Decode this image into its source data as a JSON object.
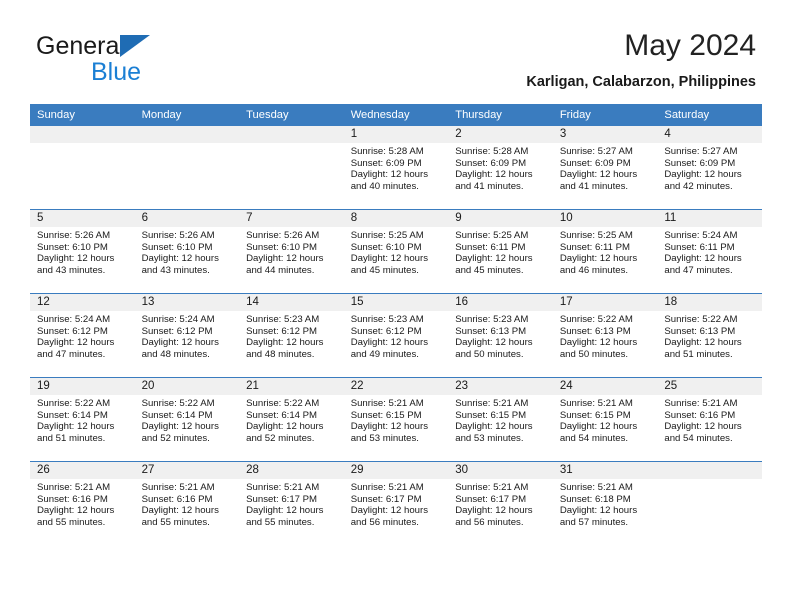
{
  "brand": {
    "name_line1": "General",
    "name_line2": "Blue",
    "triangle_color": "#1f6cb4",
    "blue_text_color": "#1b7fd4"
  },
  "header": {
    "month_title": "May 2024",
    "location": "Karligan, Calabarzon, Philippines"
  },
  "calendar": {
    "header_bg": "#3a7cbf",
    "daynum_bg": "#f0f0f0",
    "weekdays": [
      "Sunday",
      "Monday",
      "Tuesday",
      "Wednesday",
      "Thursday",
      "Friday",
      "Saturday"
    ],
    "weeks": [
      [
        {
          "day": "",
          "lines": []
        },
        {
          "day": "",
          "lines": []
        },
        {
          "day": "",
          "lines": []
        },
        {
          "day": "1",
          "lines": [
            "Sunrise: 5:28 AM",
            "Sunset: 6:09 PM",
            "Daylight: 12 hours",
            "and 40 minutes."
          ]
        },
        {
          "day": "2",
          "lines": [
            "Sunrise: 5:28 AM",
            "Sunset: 6:09 PM",
            "Daylight: 12 hours",
            "and 41 minutes."
          ]
        },
        {
          "day": "3",
          "lines": [
            "Sunrise: 5:27 AM",
            "Sunset: 6:09 PM",
            "Daylight: 12 hours",
            "and 41 minutes."
          ]
        },
        {
          "day": "4",
          "lines": [
            "Sunrise: 5:27 AM",
            "Sunset: 6:09 PM",
            "Daylight: 12 hours",
            "and 42 minutes."
          ]
        }
      ],
      [
        {
          "day": "5",
          "lines": [
            "Sunrise: 5:26 AM",
            "Sunset: 6:10 PM",
            "Daylight: 12 hours",
            "and 43 minutes."
          ]
        },
        {
          "day": "6",
          "lines": [
            "Sunrise: 5:26 AM",
            "Sunset: 6:10 PM",
            "Daylight: 12 hours",
            "and 43 minutes."
          ]
        },
        {
          "day": "7",
          "lines": [
            "Sunrise: 5:26 AM",
            "Sunset: 6:10 PM",
            "Daylight: 12 hours",
            "and 44 minutes."
          ]
        },
        {
          "day": "8",
          "lines": [
            "Sunrise: 5:25 AM",
            "Sunset: 6:10 PM",
            "Daylight: 12 hours",
            "and 45 minutes."
          ]
        },
        {
          "day": "9",
          "lines": [
            "Sunrise: 5:25 AM",
            "Sunset: 6:11 PM",
            "Daylight: 12 hours",
            "and 45 minutes."
          ]
        },
        {
          "day": "10",
          "lines": [
            "Sunrise: 5:25 AM",
            "Sunset: 6:11 PM",
            "Daylight: 12 hours",
            "and 46 minutes."
          ]
        },
        {
          "day": "11",
          "lines": [
            "Sunrise: 5:24 AM",
            "Sunset: 6:11 PM",
            "Daylight: 12 hours",
            "and 47 minutes."
          ]
        }
      ],
      [
        {
          "day": "12",
          "lines": [
            "Sunrise: 5:24 AM",
            "Sunset: 6:12 PM",
            "Daylight: 12 hours",
            "and 47 minutes."
          ]
        },
        {
          "day": "13",
          "lines": [
            "Sunrise: 5:24 AM",
            "Sunset: 6:12 PM",
            "Daylight: 12 hours",
            "and 48 minutes."
          ]
        },
        {
          "day": "14",
          "lines": [
            "Sunrise: 5:23 AM",
            "Sunset: 6:12 PM",
            "Daylight: 12 hours",
            "and 48 minutes."
          ]
        },
        {
          "day": "15",
          "lines": [
            "Sunrise: 5:23 AM",
            "Sunset: 6:12 PM",
            "Daylight: 12 hours",
            "and 49 minutes."
          ]
        },
        {
          "day": "16",
          "lines": [
            "Sunrise: 5:23 AM",
            "Sunset: 6:13 PM",
            "Daylight: 12 hours",
            "and 50 minutes."
          ]
        },
        {
          "day": "17",
          "lines": [
            "Sunrise: 5:22 AM",
            "Sunset: 6:13 PM",
            "Daylight: 12 hours",
            "and 50 minutes."
          ]
        },
        {
          "day": "18",
          "lines": [
            "Sunrise: 5:22 AM",
            "Sunset: 6:13 PM",
            "Daylight: 12 hours",
            "and 51 minutes."
          ]
        }
      ],
      [
        {
          "day": "19",
          "lines": [
            "Sunrise: 5:22 AM",
            "Sunset: 6:14 PM",
            "Daylight: 12 hours",
            "and 51 minutes."
          ]
        },
        {
          "day": "20",
          "lines": [
            "Sunrise: 5:22 AM",
            "Sunset: 6:14 PM",
            "Daylight: 12 hours",
            "and 52 minutes."
          ]
        },
        {
          "day": "21",
          "lines": [
            "Sunrise: 5:22 AM",
            "Sunset: 6:14 PM",
            "Daylight: 12 hours",
            "and 52 minutes."
          ]
        },
        {
          "day": "22",
          "lines": [
            "Sunrise: 5:21 AM",
            "Sunset: 6:15 PM",
            "Daylight: 12 hours",
            "and 53 minutes."
          ]
        },
        {
          "day": "23",
          "lines": [
            "Sunrise: 5:21 AM",
            "Sunset: 6:15 PM",
            "Daylight: 12 hours",
            "and 53 minutes."
          ]
        },
        {
          "day": "24",
          "lines": [
            "Sunrise: 5:21 AM",
            "Sunset: 6:15 PM",
            "Daylight: 12 hours",
            "and 54 minutes."
          ]
        },
        {
          "day": "25",
          "lines": [
            "Sunrise: 5:21 AM",
            "Sunset: 6:16 PM",
            "Daylight: 12 hours",
            "and 54 minutes."
          ]
        }
      ],
      [
        {
          "day": "26",
          "lines": [
            "Sunrise: 5:21 AM",
            "Sunset: 6:16 PM",
            "Daylight: 12 hours",
            "and 55 minutes."
          ]
        },
        {
          "day": "27",
          "lines": [
            "Sunrise: 5:21 AM",
            "Sunset: 6:16 PM",
            "Daylight: 12 hours",
            "and 55 minutes."
          ]
        },
        {
          "day": "28",
          "lines": [
            "Sunrise: 5:21 AM",
            "Sunset: 6:17 PM",
            "Daylight: 12 hours",
            "and 55 minutes."
          ]
        },
        {
          "day": "29",
          "lines": [
            "Sunrise: 5:21 AM",
            "Sunset: 6:17 PM",
            "Daylight: 12 hours",
            "and 56 minutes."
          ]
        },
        {
          "day": "30",
          "lines": [
            "Sunrise: 5:21 AM",
            "Sunset: 6:17 PM",
            "Daylight: 12 hours",
            "and 56 minutes."
          ]
        },
        {
          "day": "31",
          "lines": [
            "Sunrise: 5:21 AM",
            "Sunset: 6:18 PM",
            "Daylight: 12 hours",
            "and 57 minutes."
          ]
        },
        {
          "day": "",
          "lines": []
        }
      ]
    ]
  }
}
